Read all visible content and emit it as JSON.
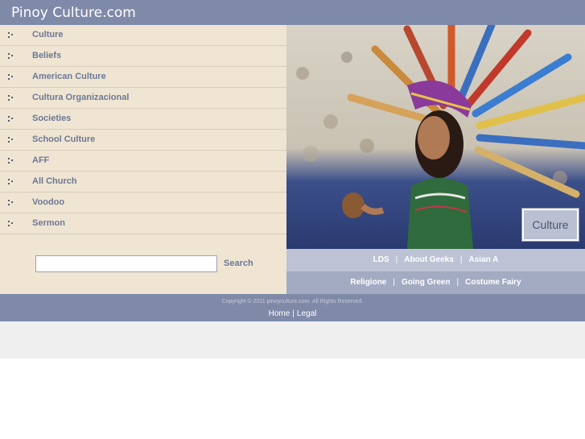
{
  "header": {
    "site_title": "Pinoy Culture.com"
  },
  "sidebar": {
    "items": [
      {
        "label": "Culture"
      },
      {
        "label": "Beliefs"
      },
      {
        "label": "American Culture"
      },
      {
        "label": "Cultura Organizacional"
      },
      {
        "label": "Societies"
      },
      {
        "label": "School Culture"
      },
      {
        "label": "AFF"
      },
      {
        "label": "All Church"
      },
      {
        "label": "Voodoo"
      },
      {
        "label": "Sermon"
      }
    ]
  },
  "search": {
    "value": "",
    "placeholder": "",
    "button_label": "Search"
  },
  "hero": {
    "caption": "Culture"
  },
  "links_row_1": {
    "items": [
      "LDS",
      "About Geeks",
      "Asian A"
    ],
    "separator": "|"
  },
  "links_row_2": {
    "items": [
      "Religione",
      "Going Green",
      "Costume Fairy"
    ],
    "separator": "|"
  },
  "footer": {
    "copyright": "Copyright © 2011 pinoyculture.com. All Rights Reserved.",
    "home_label": "Home",
    "pipe": "|",
    "legal_label": "Legal"
  },
  "colors": {
    "header_bg": "#7f8aa8",
    "sidebar_bg": "#efe5d2",
    "link_text": "#6d7896",
    "links_row_1_bg": "#bdc3d5",
    "links_row_2_bg": "#a3abc2"
  },
  "icons": {
    "nav_bullet": "dotted-bullet-icon"
  }
}
